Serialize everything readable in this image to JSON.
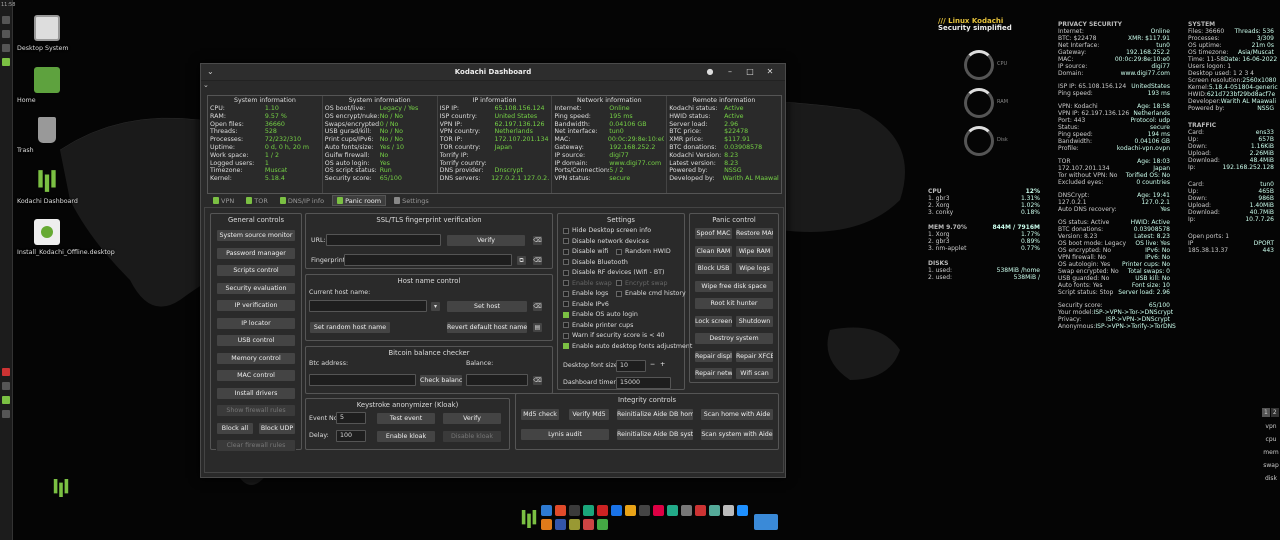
{
  "desktop": {
    "clock": "11:58",
    "icons": [
      "Desktop System",
      "Home",
      "Trash",
      "Kodachi Dashboard",
      "Install_Kodachi_Offline.desktop"
    ]
  },
  "conky_left": {
    "title": "/// Linux Kodachi",
    "subtitle": "Security simplified",
    "gauge_labels": [
      "CPU",
      "RAM",
      "Disk"
    ],
    "gauge_values": [
      "12",
      "7",
      "2"
    ],
    "cpu_header": "CPU",
    "cpu_total": "12%",
    "cpu_procs": [
      [
        "1. gbr3",
        "1.31%"
      ],
      [
        "2. Xorg",
        "1.02%"
      ],
      [
        "3. conky",
        "0.18%"
      ]
    ],
    "mem_header": "MEM 9.70%",
    "mem_total": "844M / 7916M",
    "mem_procs": [
      [
        "1. Xorg",
        "1.77%"
      ],
      [
        "2. gbr3",
        "0.89%"
      ],
      [
        "3. nm-applet",
        "0.77%"
      ]
    ],
    "disk_header": "DISKS",
    "disk_rows": [
      [
        "1. used:",
        "538MiB /home"
      ],
      [
        "2. used:",
        "538MiB /"
      ]
    ]
  },
  "conky_mid": {
    "privacy_header": "PRIVACY SECURITY",
    "privacy": [
      [
        "Internet:",
        "Online"
      ],
      [
        "BTC: $22478",
        "XMR: $117.91"
      ],
      [
        "Net Interface:",
        "tun0"
      ],
      [
        "Gateway:",
        "192.168.252.2"
      ],
      [
        "MAC:",
        "00:0c:29:8e:10:e0"
      ],
      [
        "IP source:",
        "digi77"
      ],
      [
        "Domain:",
        "www.digi77.com"
      ]
    ],
    "isp": [
      [
        "ISP IP: 65.108.156.124",
        "UnitedStates"
      ],
      [
        "Ping speed:",
        "193 ms"
      ]
    ],
    "vpn": [
      [
        "VPN: Kodachi",
        "Age: 18:58"
      ],
      [
        "VPN IP: 62.197.136.126",
        "Netherlands"
      ],
      [
        "Port: 443",
        "Protocol: udp"
      ],
      [
        "Status:",
        "secure"
      ],
      [
        "Ping speed:",
        "194 ms"
      ],
      [
        "Bandwidth:",
        "0.04106 GB"
      ],
      [
        "Profile:",
        "kodachi-vpn.ovpn"
      ]
    ],
    "tor": [
      [
        "TOR",
        "Age: 18:03"
      ],
      [
        "172.107.201.134",
        "Japan"
      ],
      [
        "Tor without VPN: No",
        "Torified OS: No"
      ],
      [
        "Excluded eyes:",
        "0 countries"
      ]
    ],
    "dns": [
      [
        "DNSCrypt:",
        "Age: 19:41"
      ],
      [
        "127.0.2.1",
        "127.0.2.1"
      ],
      [
        "Auto DNS recovery:",
        "Yes"
      ]
    ],
    "os": [
      [
        "OS status: Active",
        "HWID: Active"
      ],
      [
        "BTC donations:",
        "0.03908578"
      ],
      [
        "Version: 8.23",
        "Latest: 8.23"
      ],
      [
        "OS boot mode: Legacy",
        "OS live: Yes"
      ],
      [
        "OS encrypted: No",
        "IPv6: No"
      ],
      [
        "VPN firewall: No",
        "IPv6: No"
      ],
      [
        "OS autologin: Yes",
        "Printer cups: No"
      ],
      [
        "Swap encrypted: No",
        "Total swaps: 0"
      ],
      [
        "USB guarded: No",
        "USB kill: No"
      ],
      [
        "Auto fonts: Yes",
        "Font size: 10"
      ],
      [
        "Script status: Stop",
        "Server load: 2.96"
      ]
    ],
    "score": [
      [
        "Security score:",
        "65/100"
      ],
      [
        "Your model:",
        "ISP->VPN->Tor->DNScrypt"
      ],
      [
        "Privacy:",
        "ISP->VPN->DNScrypt"
      ],
      [
        "Anonymous:",
        "ISP->VPN->Torify->TorDNS"
      ]
    ]
  },
  "conky_right": {
    "system_header": "SYSTEM",
    "system": [
      [
        "Files: 36660",
        "Threads: 536"
      ],
      [
        "Processes:",
        "3/309"
      ],
      [
        "OS uptime:",
        "21m 0s"
      ],
      [
        "OS timezone:",
        "Asia/Muscat"
      ],
      [
        "Time: 11-58",
        "Date: 16-06-2022"
      ],
      [
        "Users logon: 1",
        ""
      ],
      [
        "Desktop used: 1 2 3 4",
        ""
      ],
      [
        "Screen resolution:",
        "2560x1080"
      ],
      [
        "Kernel:",
        "5.18.4-051804-generic"
      ],
      [
        "HWID:",
        "621d723bf29bd8acf7e"
      ],
      [
        "Developer:",
        "Warith AL Maawali"
      ],
      [
        "Powered by:",
        "NSSG"
      ]
    ],
    "traffic_header": "TRAFFIC",
    "traffic1": [
      [
        "Card:",
        "ens33"
      ],
      [
        "Up:",
        "657B"
      ],
      [
        "Down:",
        "1.16KiB"
      ],
      [
        "Upload:",
        "2.26MiB"
      ],
      [
        "Download:",
        "48.4MiB"
      ],
      [
        "Ip:",
        "192.168.252.128"
      ]
    ],
    "traffic2": [
      [
        "Card:",
        "tun0"
      ],
      [
        "Up:",
        "465B"
      ],
      [
        "Down:",
        "986B"
      ],
      [
        "Upload:",
        "1.40MiB"
      ],
      [
        "Download:",
        "40.7MiB"
      ],
      [
        "Ip:",
        "10.7.7.26"
      ]
    ],
    "ports": [
      [
        "Open ports: 1",
        ""
      ],
      [
        "IP",
        "DPORT"
      ],
      [
        "185.38.13.37",
        "443"
      ]
    ]
  },
  "window": {
    "title": "Kodachi Dashboard",
    "columns": [
      {
        "header": "System information",
        "rows": [
          [
            "CPU:",
            "1.10"
          ],
          [
            "RAM:",
            "9.57 %"
          ],
          [
            "Open files:",
            "36660"
          ],
          [
            "Threads:",
            "528"
          ],
          [
            "Processes:",
            "72/232/310"
          ],
          [
            "Uptime:",
            "0 d, 0 h, 20 m"
          ],
          [
            "Work space:",
            "1 / 2"
          ],
          [
            "Logged users:",
            "1"
          ],
          [
            "Timezone:",
            "Muscat"
          ],
          [
            "Kernel:",
            "5.18.4"
          ]
        ]
      },
      {
        "header": "System information",
        "rows": [
          [
            "OS boot/live:",
            "Legacy / Yes"
          ],
          [
            "OS encrypt/nuke:",
            "No / No"
          ],
          [
            "Swaps/encrypted:",
            "0 / No"
          ],
          [
            "USB gurad/kill:",
            "No / No"
          ],
          [
            "Print cups/IPv6:",
            "No / No"
          ],
          [
            "Auto fonts/size:",
            "Yes / 10"
          ],
          [
            "Guifw firewall:",
            "No"
          ],
          [
            "OS auto login:",
            "Yes"
          ],
          [
            "OS script status:",
            "Run"
          ],
          [
            "Security score:",
            "65/100"
          ]
        ]
      },
      {
        "header": "IP information",
        "rows": [
          [
            "ISP IP:",
            "65.108.156.124"
          ],
          [
            "ISP country:",
            "United States"
          ],
          [
            "VPN IP:",
            "62.197.136.126"
          ],
          [
            "VPN country:",
            "Netherlands"
          ],
          [
            "TOR IP:",
            "172.107.201.134"
          ],
          [
            "TOR country:",
            "Japan"
          ],
          [
            "Torrify IP:",
            ""
          ],
          [
            "Torrify country:",
            ""
          ],
          [
            "DNS provider:",
            "Dnscrypt"
          ],
          [
            "DNS servers:",
            "127.0.2.1 127.0.2.1"
          ]
        ]
      },
      {
        "header": "Network information",
        "rows": [
          [
            "Internet:",
            "Online"
          ],
          [
            "Ping speed:",
            "195 ms"
          ],
          [
            "Bandwidth:",
            "0.04106 GB"
          ],
          [
            "Net interface:",
            "tun0"
          ],
          [
            "MAC:",
            "00:0c:29:8e:10:e0"
          ],
          [
            "Gateway:",
            "192.168.252.2"
          ],
          [
            "IP source:",
            "digi77"
          ],
          [
            "IP domain:",
            "www.digi77.com"
          ],
          [
            "Ports/Connections:",
            "5 / 2"
          ],
          [
            "VPN status:",
            "secure"
          ]
        ]
      },
      {
        "header": "Remote information",
        "rows": [
          [
            "Kodachi status:",
            "Active"
          ],
          [
            "HWID status:",
            "Active"
          ],
          [
            "Server load:",
            "2.96"
          ],
          [
            "BTC price:",
            "$22478"
          ],
          [
            "XMR price:",
            "$117.91"
          ],
          [
            "BTC donations:",
            "0.03908578"
          ],
          [
            "Kodachi Version:",
            "8.23"
          ],
          [
            "Latest version:",
            "8.23"
          ],
          [
            "Powered by:",
            "NSSG"
          ],
          [
            "Developed by:",
            "Warith AL Maawali"
          ]
        ]
      }
    ],
    "tabs": [
      "VPN",
      "TOR",
      "DNS/IP info",
      "Panic room",
      "Settings"
    ],
    "general": {
      "title": "General controls",
      "buttons": [
        "System source monitor",
        "Password manager",
        "Scripts control",
        "Security evaluation",
        "IP verification",
        "IP locator",
        "USB control",
        "Memory control",
        "MAC control",
        "Install drivers",
        "Show firewall rules",
        "Block all",
        "Block UDP",
        "Clear firewall rules"
      ]
    },
    "ssl": {
      "title": "SSL/TLS fingerprint verification",
      "url_label": "URL:",
      "fp_label": "Fingerprint:",
      "verify": "Verify"
    },
    "hostname": {
      "title": "Host name control",
      "current_label": "Current host name:",
      "set_host": "Set host",
      "set_random": "Set random host name",
      "revert": "Revert default host name"
    },
    "btc": {
      "title": "Bitcoin balance checker",
      "address_label": "Btc address:",
      "balance_label": "Balance:",
      "check": "Check balance"
    },
    "keystroke": {
      "title": "Keystroke anonymizer (Kloak)",
      "event_label": "Event No:",
      "event_value": "5",
      "delay_label": "Delay:",
      "delay_value": "100",
      "test": "Test event",
      "verify": "Verify",
      "enable": "Enable kloak",
      "disable": "Disable kloak"
    },
    "settings": {
      "title": "Settings",
      "checks": [
        "Hide Desktop screen info",
        "Disable network devices",
        "Disable wifi",
        "Random HWID",
        "Disable Bluetooth",
        "Disable RF devices (Wifi - BT)",
        "Enable swap",
        "Encrypt swap",
        "Enable logs",
        "Enable cmd history",
        "Enable IPv6",
        "Enable OS auto login",
        "Enable printer cups",
        "Warn if security score is < 40",
        "Enable auto desktop fonts adjustment"
      ],
      "font_label": "Desktop font size:",
      "font_value": "10",
      "timer_label": "Dashboard timer:",
      "timer_value": "15000"
    },
    "panic": {
      "title": "Panic control",
      "buttons": [
        "Spoof MAC",
        "Restore MAC",
        "Clean RAM",
        "Wipe RAM",
        "Block USB",
        "Wipe logs",
        "Wipe free disk space",
        "Root kit hunter",
        "Lock screen",
        "Shutdown",
        "Destroy system",
        "Repair display",
        "Repair XFCE",
        "Repair network",
        "Wifi scan"
      ]
    },
    "integrity": {
      "title": "Integrity controls",
      "buttons": [
        "Md5 check",
        "Verify Md5",
        "Reinitialize Aide DB home",
        "Scan home with Aide",
        "Lynis audit",
        "Reinitialize Aide DB system",
        "Scan system with Aide"
      ]
    }
  },
  "right_panel": {
    "workspaces": [
      "1",
      "2"
    ],
    "items": [
      "vpn",
      "cpu",
      "mem",
      "swap",
      "disk"
    ]
  },
  "colors": {
    "accent": "#7bc043",
    "value_green": "#75d145",
    "title_yellow": "#e6c23a"
  }
}
